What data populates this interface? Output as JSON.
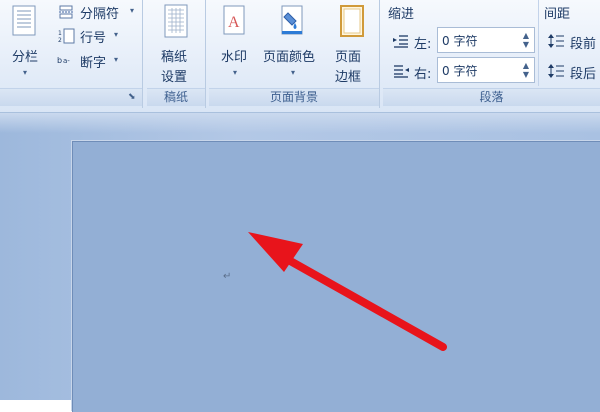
{
  "ribbon": {
    "page_setup": {
      "columns_label": "分栏",
      "breaks_label": "分隔符",
      "line_numbers_label": "行号",
      "hyphenation_label": "断字"
    },
    "manuscript": {
      "settings_line1": "稿纸",
      "settings_line2": "设置",
      "group_label": "稿纸"
    },
    "page_background": {
      "watermark_label": "水印",
      "page_color_label": "页面颜色",
      "page_border_line1": "页面",
      "page_border_line2": "边框",
      "group_label": "页面背景"
    },
    "paragraph": {
      "indent_header": "缩进",
      "indent_left_label": "左:",
      "indent_left_value": "0 字符",
      "indent_right_label": "右:",
      "indent_right_value": "0 字符",
      "spacing_header": "间距",
      "spacing_before_label": "段前",
      "spacing_after_label": "段后",
      "group_label": "段落"
    }
  },
  "document": {
    "paragraph_mark": "↵"
  },
  "colors": {
    "arrow": "#e8141b",
    "page_background": "#93afd5",
    "workspace": "#a9c1e2"
  },
  "icons": [
    "columns-icon",
    "breaks-icon",
    "line-numbers-icon",
    "hyphenation-icon",
    "manuscript-icon",
    "watermark-icon",
    "page-color-icon",
    "page-border-icon",
    "indent-left-icon",
    "indent-right-icon",
    "spacing-before-icon",
    "spacing-after-icon",
    "launcher-icon"
  ]
}
